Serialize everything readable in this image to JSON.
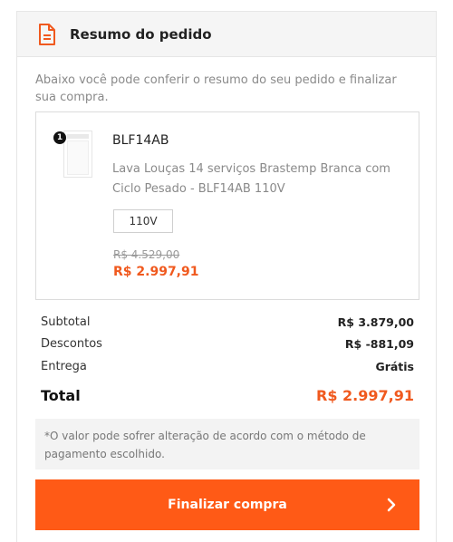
{
  "header": {
    "title": "Resumo do pedido",
    "icon": "document-icon"
  },
  "intro": "Abaixo você pode conferir o resumo do seu pedido e finalizar sua compra.",
  "product": {
    "quantity": "1",
    "sku": "BLF14AB",
    "name": "Lava Louças 14 serviços Brastemp Branca com Ciclo Pesado - BLF14AB 110V",
    "variant": "110V",
    "old_price": "R$ 4.529,00",
    "price": "R$ 2.997,91"
  },
  "totals": {
    "subtotal_label": "Subtotal",
    "subtotal_value": "R$ 3.879,00",
    "discount_label": "Descontos",
    "discount_value": "R$ -881,09",
    "shipping_label": "Entrega",
    "shipping_value": "Grátis",
    "total_label": "Total",
    "total_value": "R$ 2.997,91"
  },
  "note": "*O valor pode sofrer alteração de acordo com o método de pagamento escolhido.",
  "cta": {
    "label": "Finalizar compra",
    "icon": "chevron-right-icon"
  },
  "colors": {
    "accent": "#ff5a16",
    "price": "#f0591e",
    "muted": "#8a8a8a"
  }
}
